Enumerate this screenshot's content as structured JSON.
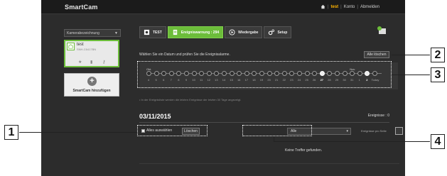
{
  "topbar": {
    "logo_main": "SmartCam",
    "logo_accent": "",
    "user": "test",
    "konto": "Konto",
    "abmelden": "Abmelden",
    "separator": "|"
  },
  "sidebar": {
    "sort_label": "Kamerabezeichnung",
    "camera": {
      "name": "test",
      "id": "SNH-C6417BN"
    },
    "add_label": "SmartCam hinzufügen"
  },
  "tabs": [
    {
      "label": "TEST",
      "icon": "camera-icon"
    },
    {
      "label": "Ereigniswarnung : 294",
      "icon": "alert-icon"
    },
    {
      "label": "Wiedergabe",
      "icon": "play-icon"
    },
    {
      "label": "Setup",
      "icon": "gear-icon"
    }
  ],
  "panel": {
    "instruction": "Wählen Sie ein Datum und prüfen Sie die Ereignisalarme.",
    "delete_all": "Alle löschen",
    "months": [
      "Okt.",
      "Nov."
    ],
    "days": [
      "4",
      "5",
      "6",
      "7",
      "8",
      "9",
      "10",
      "11",
      "12",
      "13",
      "14",
      "15",
      "16",
      "17",
      "18",
      "19",
      "20",
      "21",
      "22",
      "23",
      "24",
      "25",
      "26",
      "27",
      "28",
      "29",
      "30",
      "31",
      "1",
      "2",
      "Today"
    ],
    "active_days": [
      "27",
      "2"
    ],
    "note": "• In der Ereignisliste werden die letzten Ereignisse der letzten 30 Tage angezeigt.",
    "date": "03/11/2015",
    "events_label": "Ereignisse : 0",
    "select_all": "Alles auswählen",
    "delete": "Löschen",
    "filter_value": "Alle",
    "per_page_label": "Ereignisse pro Seite",
    "no_results": "Keine Treffer gefunden."
  },
  "callouts": [
    "1",
    "2",
    "3",
    "4"
  ],
  "colors": {
    "accent": "#6cbd3a",
    "user": "#ffb400",
    "background": "#2c2c2c"
  }
}
